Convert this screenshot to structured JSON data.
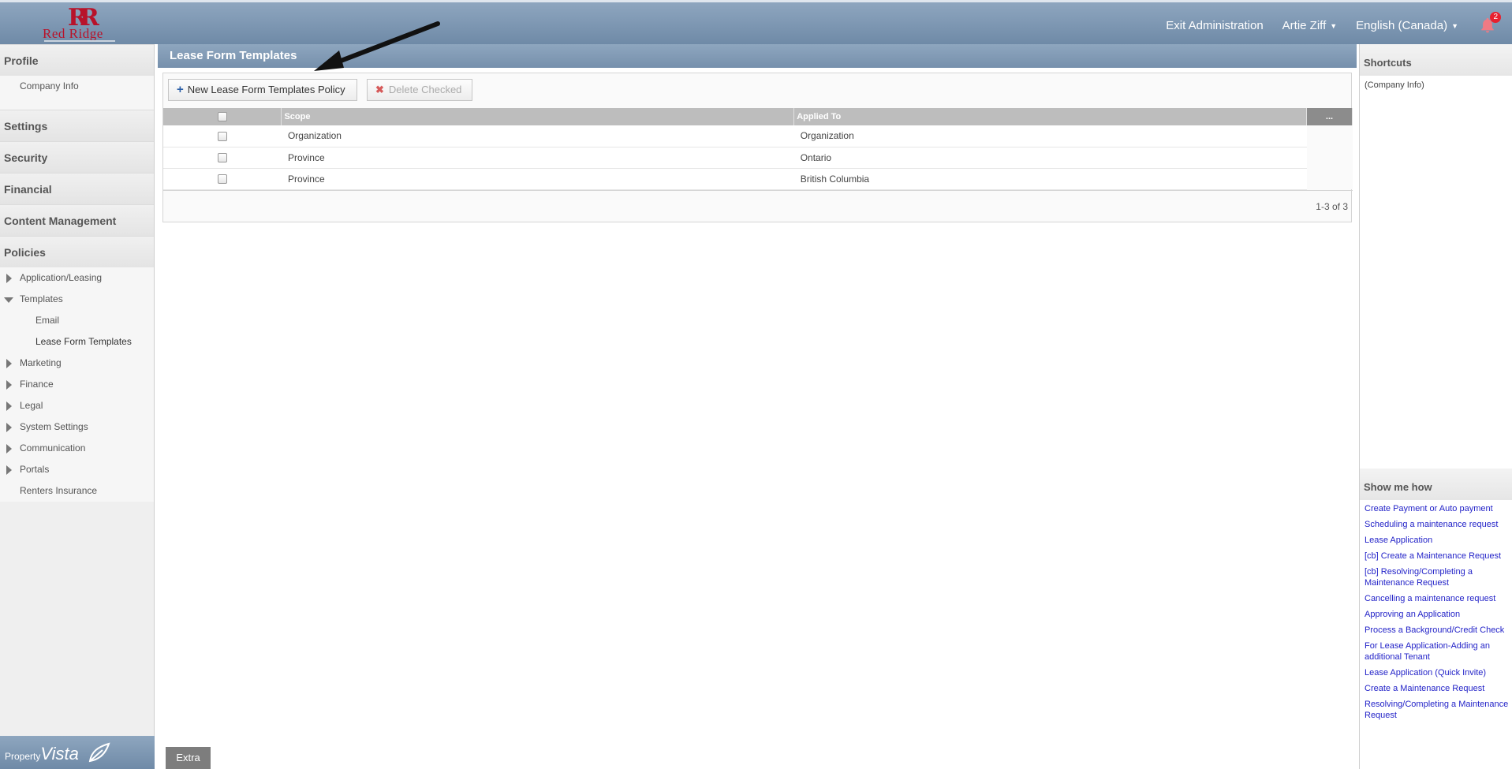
{
  "brand": {
    "logo_mark": "RR",
    "logo_text": "Red Ridge"
  },
  "topnav": {
    "exit_admin": "Exit Administration",
    "user": "Artie Ziff",
    "language": "English (Canada)",
    "notification_count": "2"
  },
  "sidebar": {
    "profile": "Profile",
    "company_info": "Company Info",
    "settings": "Settings",
    "security": "Security",
    "financial": "Financial",
    "content_management": "Content Management",
    "policies": "Policies",
    "policy_items": {
      "application_leasing": "Application/Leasing",
      "templates": "Templates",
      "email": "Email",
      "lease_form_templates": "Lease Form Templates",
      "marketing": "Marketing",
      "finance": "Finance",
      "legal": "Legal",
      "system_settings": "System Settings",
      "communication": "Communication",
      "portals": "Portals",
      "renters_insurance": "Renters Insurance"
    },
    "footer_property": "Property",
    "footer_vista": "Vista"
  },
  "main": {
    "title": "Lease Form Templates",
    "new_button": "New Lease Form Templates Policy",
    "delete_button": "Delete Checked",
    "columns": {
      "scope": "Scope",
      "applied_to": "Applied To",
      "actions": "..."
    },
    "rows": [
      {
        "scope": "Organization",
        "applied_to": "Organization"
      },
      {
        "scope": "Province",
        "applied_to": "Ontario"
      },
      {
        "scope": "Province",
        "applied_to": "British Columbia"
      }
    ],
    "pager": "1-3 of 3",
    "extra_tab": "Extra"
  },
  "rightbar": {
    "shortcuts_title": "Shortcuts",
    "shortcut_item": "(Company Info)",
    "show_me_how_title": "Show me how",
    "how_items": [
      "Create Payment or Auto payment",
      "Scheduling a maintenance request",
      "Lease Application",
      "[cb] Create a Maintenance Request",
      "[cb] Resolving/Completing a Maintenance Request",
      "Cancelling a maintenance request",
      "Approving an Application",
      "Process a Background/Credit Check",
      "For Lease Application-Adding an additional Tenant",
      "Lease Application (Quick Invite)",
      "Create a Maintenance Request",
      "Resolving/Completing a Maintenance Request"
    ]
  }
}
